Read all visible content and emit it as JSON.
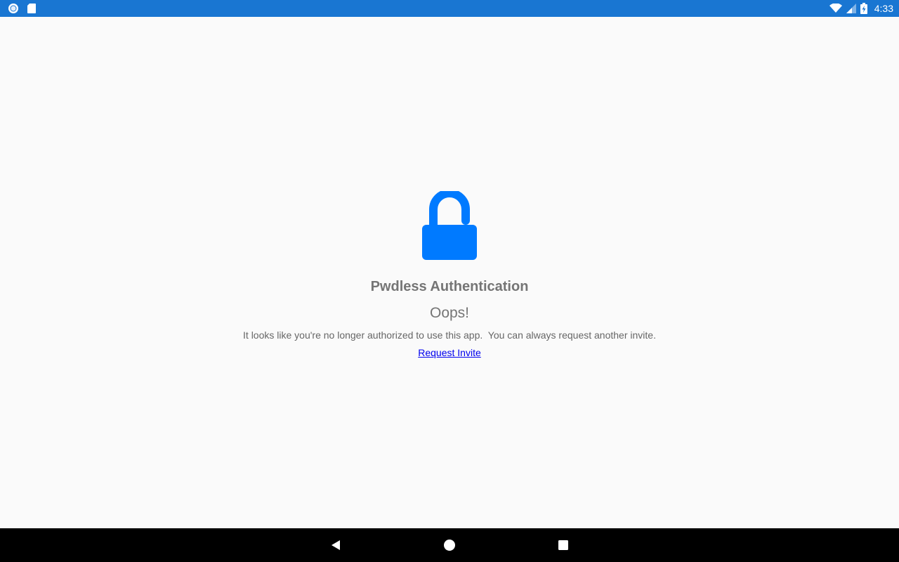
{
  "status_bar": {
    "time": "4:33",
    "left_icons": [
      "circle-notification-icon",
      "sd-card-icon"
    ],
    "right_icons": [
      "wifi-icon",
      "cell-signal-icon",
      "battery-charging-icon"
    ],
    "background_color": "#1976d2"
  },
  "main": {
    "icon": "unlocked-padlock-icon",
    "icon_color": "#007aff",
    "title": "Pwdless Authentication",
    "heading": "Oops!",
    "message": "It looks like you're no longer authorized to use this app.  You can always request another invite.",
    "link_label": "Request Invite"
  },
  "nav_bar": {
    "buttons": [
      "back-icon",
      "home-icon",
      "recents-icon"
    ]
  }
}
